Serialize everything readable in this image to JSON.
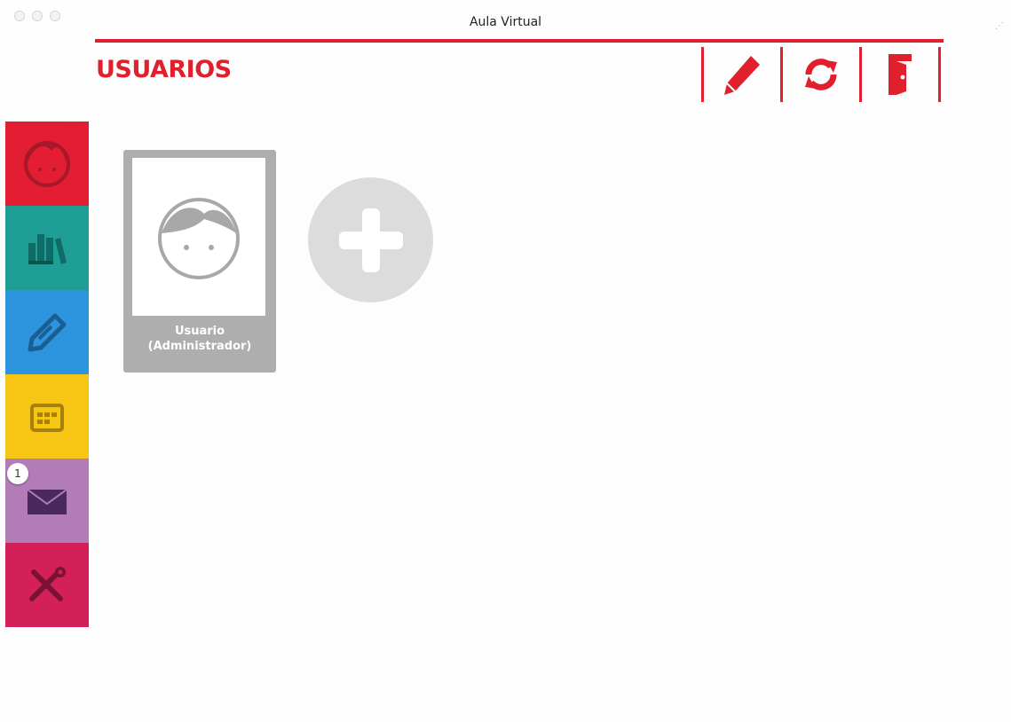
{
  "window": {
    "title": "Aula Virtual"
  },
  "header": {
    "title": "USUARIOS",
    "accent_color": "#e0202c",
    "toolbar": [
      {
        "icon": "pencil-icon",
        "action": "edit"
      },
      {
        "icon": "refresh-icon",
        "action": "refresh"
      },
      {
        "icon": "exit-door-icon",
        "action": "exit"
      }
    ]
  },
  "sidebar": {
    "items": [
      {
        "icon": "user-face-icon",
        "color": "#e31d32",
        "active": true
      },
      {
        "icon": "books-icon",
        "color": "#1f9e96"
      },
      {
        "icon": "pencil-icon",
        "color": "#2d95e0"
      },
      {
        "icon": "calendar-icon",
        "color": "#f7c614"
      },
      {
        "icon": "mail-icon",
        "color": "#b27db7",
        "badge": "1"
      },
      {
        "icon": "tools-icon",
        "color": "#d42059"
      }
    ]
  },
  "users": [
    {
      "name_line1": "Usuario",
      "name_line2": "(Administrador)",
      "avatar": "user-face-icon"
    }
  ],
  "add_user": {
    "icon": "plus-icon"
  }
}
